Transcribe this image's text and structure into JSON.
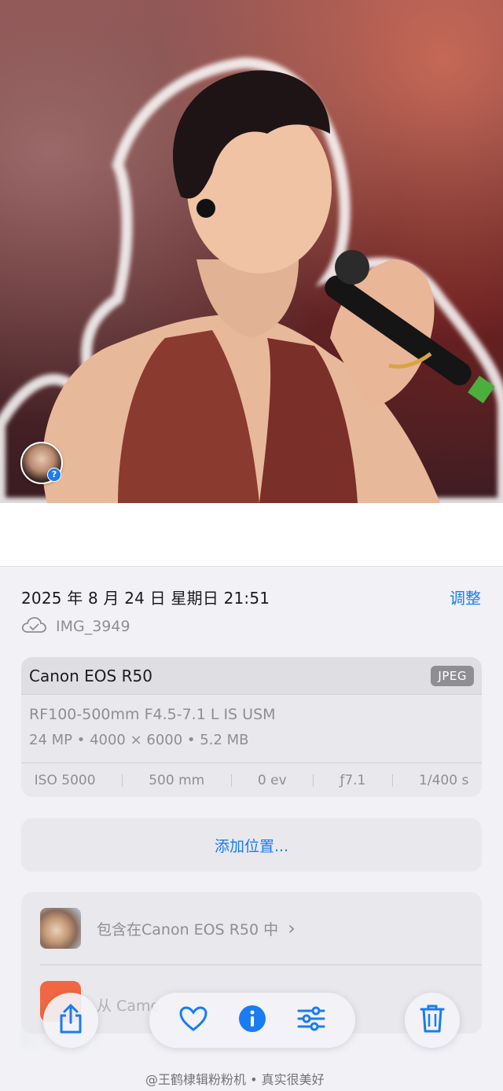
{
  "meta": {
    "datetime": "2025 年 8 月 24 日 星期日 21:51",
    "adjust_label": "调整",
    "filename": "IMG_3949"
  },
  "camera": {
    "name": "Canon EOS R50",
    "format": "JPEG",
    "lens": "RF100-500mm F4.5-7.1 L IS USM",
    "specs": "24 MP • 4000 × 6000 • 5.2 MB",
    "exif": {
      "iso": "ISO 5000",
      "focal": "500 mm",
      "ev": "0 ev",
      "aperture": "ƒ7.1",
      "shutter": "1/400 s"
    }
  },
  "location": {
    "add_label": "添加位置..."
  },
  "album": {
    "included_in": "包含在Canon EOS R50 中",
    "chevron": "›",
    "second_row": "从 Came"
  },
  "toolbar": {
    "share": "share-icon",
    "favorite": "heart-icon",
    "info": "info-icon",
    "edit": "sliders-icon",
    "delete": "trash-icon"
  },
  "watermark": "@王鹤棣辑粉粉机 • 真实很美好",
  "colors": {
    "accent": "#1a7cf0"
  }
}
